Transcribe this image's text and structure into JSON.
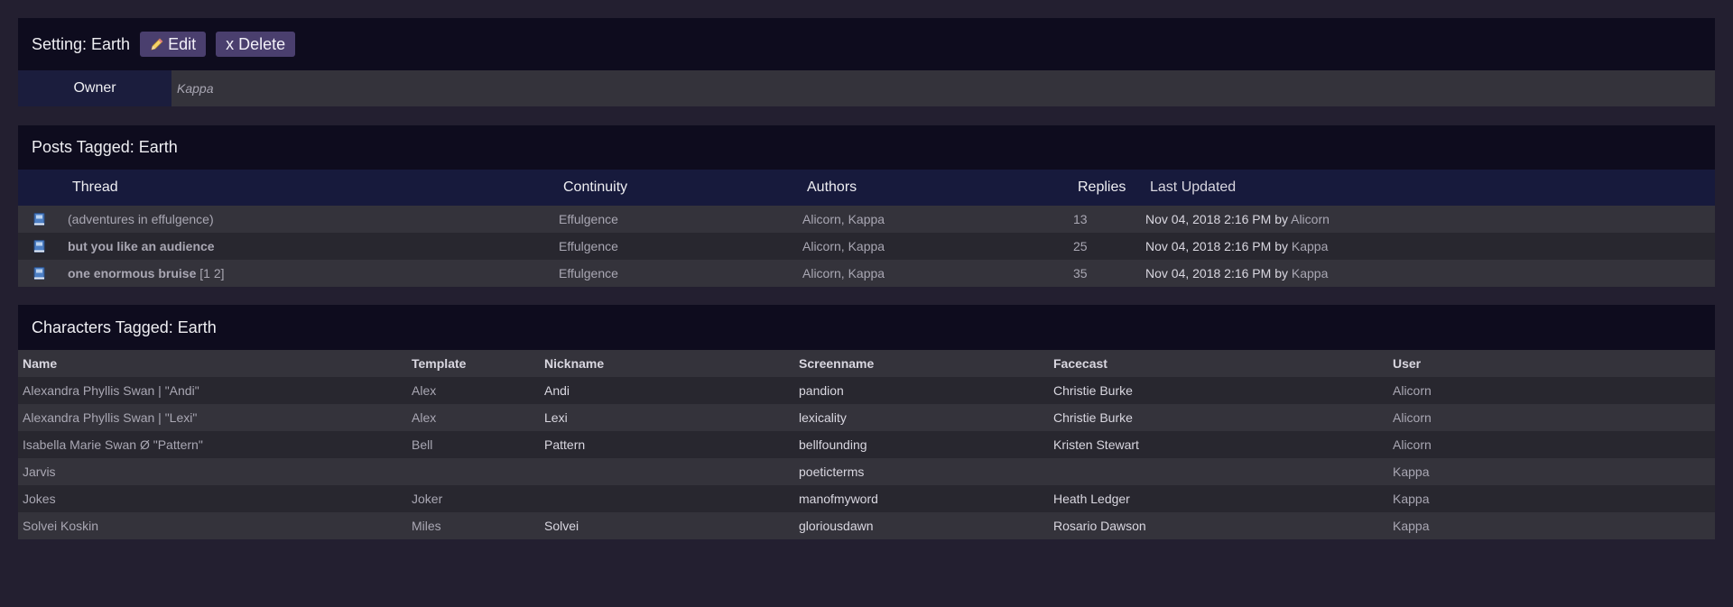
{
  "setting": {
    "title": "Setting: Earth",
    "edit_label": "Edit",
    "delete_label": "x Delete",
    "owner_label": "Owner",
    "owner_value": "Kappa"
  },
  "posts": {
    "title": "Posts Tagged: Earth",
    "headers": {
      "thread": "Thread",
      "continuity": "Continuity",
      "authors": "Authors",
      "replies": "Replies",
      "last_updated": "Last Updated"
    },
    "rows": [
      {
        "thread": "(adventures in effulgence)",
        "bold": false,
        "pages": "",
        "continuity": "Effulgence",
        "authors": "Alicorn, Kappa",
        "replies": "13",
        "updated": "Nov 04, 2018 2:16 PM by ",
        "updated_by": "Alicorn"
      },
      {
        "thread": "but you like an audience",
        "bold": true,
        "pages": "",
        "continuity": "Effulgence",
        "authors": "Alicorn, Kappa",
        "replies": "25",
        "updated": "Nov 04, 2018 2:16 PM by ",
        "updated_by": "Kappa"
      },
      {
        "thread": "one enormous bruise",
        "bold": true,
        "pages": " [1 2]",
        "continuity": "Effulgence",
        "authors": "Alicorn, Kappa",
        "replies": "35",
        "updated": "Nov 04, 2018 2:16 PM by ",
        "updated_by": "Kappa"
      }
    ]
  },
  "characters": {
    "title": "Characters Tagged: Earth",
    "headers": {
      "name": "Name",
      "template": "Template",
      "nickname": "Nickname",
      "screenname": "Screenname",
      "facecast": "Facecast",
      "user": "User"
    },
    "rows": [
      {
        "name": "Alexandra Phyllis Swan | \"Andi\"",
        "template": "Alex",
        "nickname": "Andi",
        "screenname": "pandion",
        "facecast": "Christie Burke",
        "user": "Alicorn"
      },
      {
        "name": "Alexandra Phyllis Swan | \"Lexi\"",
        "template": "Alex",
        "nickname": "Lexi",
        "screenname": "lexicality",
        "facecast": "Christie Burke",
        "user": "Alicorn"
      },
      {
        "name": "Isabella Marie Swan Ø \"Pattern\"",
        "template": "Bell",
        "nickname": "Pattern",
        "screenname": "bellfounding",
        "facecast": "Kristen Stewart",
        "user": "Alicorn"
      },
      {
        "name": "Jarvis",
        "template": "",
        "nickname": "",
        "screenname": "poeticterms",
        "facecast": "",
        "user": "Kappa"
      },
      {
        "name": "Jokes",
        "template": "Joker",
        "nickname": "",
        "screenname": "manofmyword",
        "facecast": "Heath Ledger",
        "user": "Kappa"
      },
      {
        "name": "Solvei Koskin",
        "template": "Miles",
        "nickname": "Solvei",
        "screenname": "gloriousdawn",
        "facecast": "Rosario Dawson",
        "user": "Kappa"
      }
    ]
  },
  "colors": {
    "background": "#231f30",
    "header_dark": "#0e0c1e",
    "header_blue": "#171a3c",
    "button": "#4a3f6e"
  }
}
